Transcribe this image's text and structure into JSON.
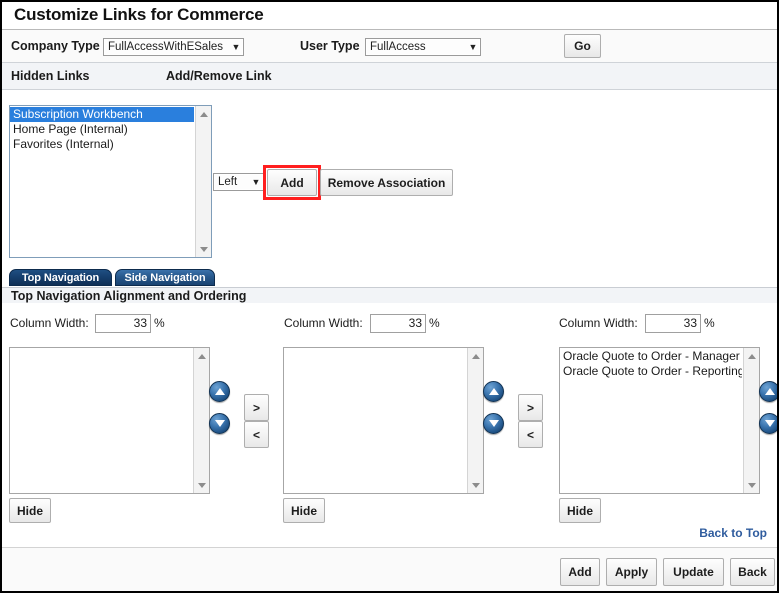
{
  "page": {
    "title": "Customize Links for Commerce"
  },
  "filters": {
    "company_type_label": "Company Type",
    "company_type_value": "FullAccessWithESales",
    "user_type_label": "User Type",
    "user_type_value": "FullAccess",
    "go_label": "Go"
  },
  "column_headers": {
    "hidden_links": "Hidden Links",
    "add_remove_link": "Add/Remove Link"
  },
  "hidden_links_list": {
    "items": [
      {
        "label": "Subscription Workbench",
        "selected": true
      },
      {
        "label": "Home Page (Internal)",
        "selected": false
      },
      {
        "label": "Favorites (Internal)",
        "selected": false
      }
    ]
  },
  "association": {
    "position_value": "Left",
    "add_label": "Add",
    "remove_label": "Remove Association",
    "highlight_color": "#ff1f1f"
  },
  "tabs": [
    {
      "label": "Top Navigation",
      "active": true
    },
    {
      "label": "Side Navigation",
      "active": false
    }
  ],
  "section_title": "Top Navigation Alignment and Ordering",
  "columns": [
    {
      "width_label": "Column Width:",
      "width_value": "33",
      "percent": "%",
      "items": [],
      "hide_label": "Hide",
      "move_right": ">",
      "move_left": "<"
    },
    {
      "width_label": "Column Width:",
      "width_value": "33",
      "percent": "%",
      "items": [],
      "hide_label": "Hide",
      "move_right": ">",
      "move_left": "<"
    },
    {
      "width_label": "Column Width:",
      "width_value": "33",
      "percent": "%",
      "items": [
        "Oracle Quote to Order - Manager",
        "Oracle Quote to Order - Reporting"
      ],
      "hide_label": "Hide"
    }
  ],
  "footer": {
    "back_to_top": "Back to Top",
    "buttons": [
      {
        "label": "Add"
      },
      {
        "label": "Apply"
      },
      {
        "label": "Update"
      },
      {
        "label": "Back"
      }
    ]
  },
  "colors": {
    "selection_blue": "#2a7fdd",
    "link_blue": "#2f5c9e",
    "tab_navy": "#163f6e"
  }
}
